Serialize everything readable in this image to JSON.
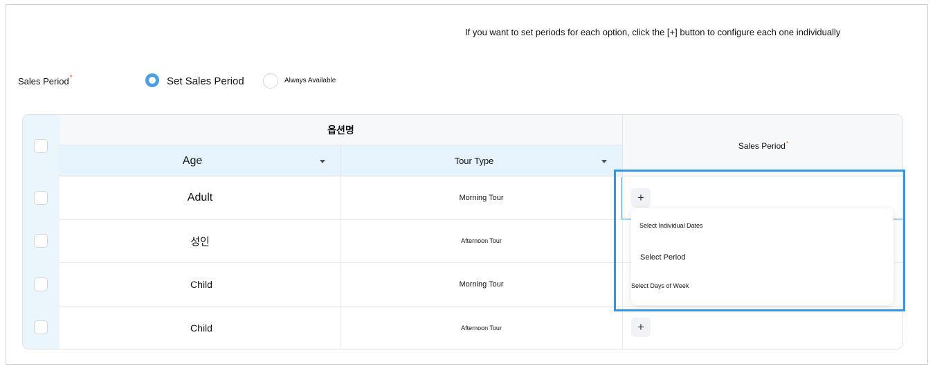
{
  "hint_text": "If you want to set periods for each option, click the [+] button to configure each one individually",
  "sales_period": {
    "label": "Sales Period",
    "required_mark": "*",
    "option_set": "Set Sales Period",
    "option_always": "Always Available",
    "selected": "Set Sales Period"
  },
  "table": {
    "group_header": "옵션명",
    "col_age": "Age",
    "col_tour_type": "Tour Type",
    "col_sales_period": "Sales Period",
    "col_sales_period_mark": "*",
    "rows": [
      {
        "age": "Adult",
        "tour_type": "Morning Tour"
      },
      {
        "age": "성인",
        "tour_type": "Afternoon Tour"
      },
      {
        "age": "Child",
        "tour_type": "Morning Tour"
      },
      {
        "age": "Child",
        "tour_type": "Afternoon Tour"
      }
    ],
    "add_symbol": "+"
  },
  "dropdown_menu": {
    "items": [
      "Select Individual Dates",
      "Select Period",
      "Select Days of Week"
    ]
  },
  "colors": {
    "accent": "#3296e6",
    "radio_selected": "#4a9fe8",
    "header_blue": "#e6f3fc",
    "required": "#e0352b"
  }
}
